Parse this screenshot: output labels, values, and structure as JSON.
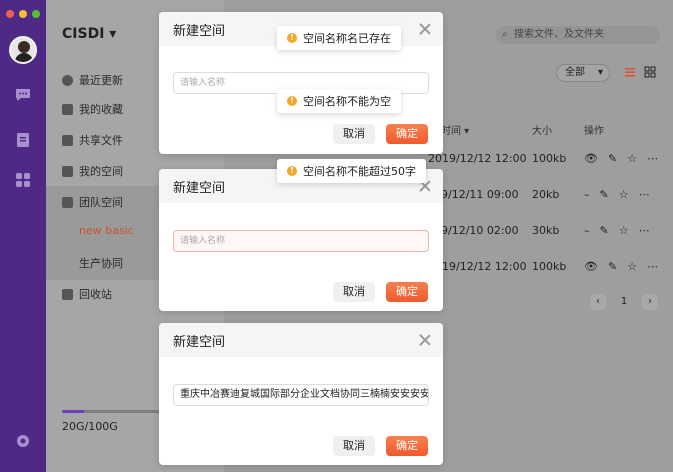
{
  "app": {
    "brand": "CISDI"
  },
  "traffic_lights": [
    "#ec5f56",
    "#f5bd2f",
    "#52c232"
  ],
  "sidebar": {
    "items": [
      {
        "label": "最近更新",
        "icon": "clock-icon"
      },
      {
        "label": "我的收藏",
        "icon": "star-icon"
      },
      {
        "label": "共享文件",
        "icon": "folder-icon"
      },
      {
        "label": "我的空间",
        "icon": "home-icon"
      },
      {
        "label": "团队空间",
        "icon": "cube-icon"
      },
      {
        "label": "new basic",
        "icon": ""
      },
      {
        "label": "生产协同",
        "icon": ""
      },
      {
        "label": "回收站",
        "icon": "trash-icon"
      }
    ],
    "storage": "20G/100G",
    "storage_fraction": 0.2
  },
  "header": {
    "search_placeholder": "搜索文件、及文件夹",
    "filter_value": "全部"
  },
  "table": {
    "columns": [
      "时间",
      "大小",
      "操作"
    ],
    "rows": [
      {
        "time": "2019/12/12 12:00",
        "size": "100kb"
      },
      {
        "time": "9/12/11  09:00",
        "size": "20kb"
      },
      {
        "time": "9/12/10  02:00",
        "size": "30kb"
      },
      {
        "time": "2019/12/12 12:00",
        "size": "100kb"
      }
    ],
    "page": "1"
  },
  "dialogs": [
    {
      "title": "新建空间",
      "placeholder": "请输入名称",
      "value": "",
      "cancel": "取消",
      "ok": "确定"
    },
    {
      "title": "新建空间",
      "placeholder": "请输入名称",
      "value": "",
      "cancel": "取消",
      "ok": "确定"
    },
    {
      "title": "新建空间",
      "placeholder": "请输入名称",
      "value": "重庆中冶赛迪复城国际部分企业文档协同三楠楠安安安安娜啊",
      "cancel": "取消",
      "ok": "确定"
    }
  ],
  "toasts": [
    "空间名称名已存在",
    "空间名称不能为空",
    "空间名称不能超过50字"
  ],
  "colors": {
    "rail": "#4e2a86",
    "accent": "#f05a2f",
    "warn": "#f5a623"
  }
}
